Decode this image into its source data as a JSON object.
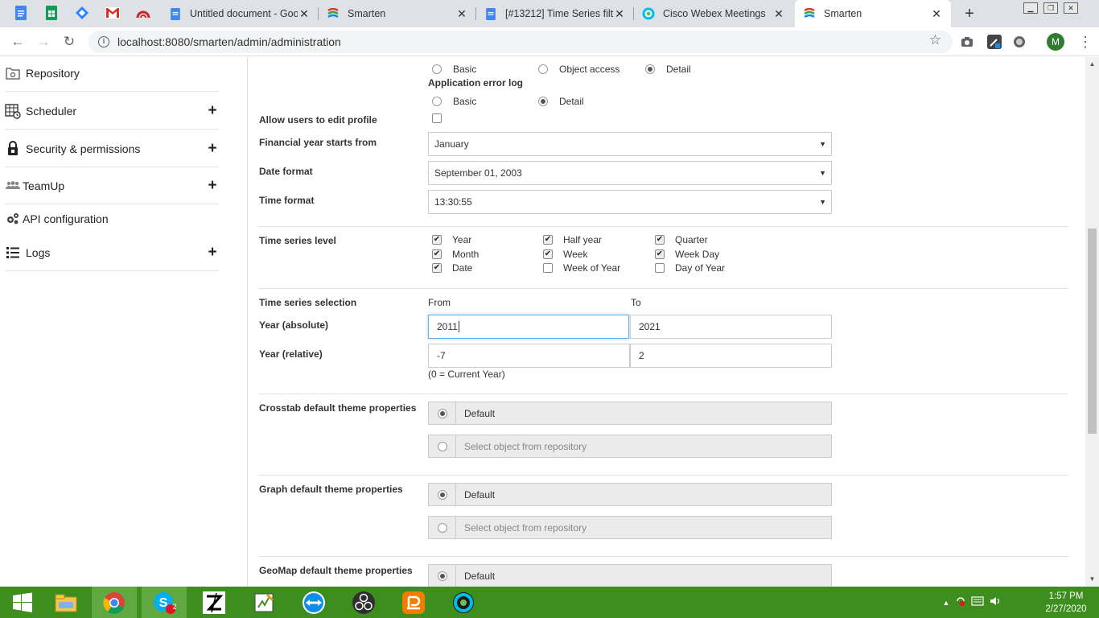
{
  "browser": {
    "tabs": [
      {
        "title": "Untitled document - Goo",
        "icon": "google-docs-icon"
      },
      {
        "title": "Smarten",
        "icon": "smarten-icon"
      },
      {
        "title": "[#13212] Time Series filte",
        "icon": "google-docs-icon"
      },
      {
        "title": "Cisco Webex Meetings",
        "icon": "webex-icon"
      },
      {
        "title": "Smarten",
        "icon": "smarten-icon",
        "active": true
      }
    ],
    "pinned_icons": [
      "google-docs-icon",
      "google-sheets-icon",
      "jira-icon",
      "gmail-icon",
      "smarten-red-icon"
    ],
    "url": "localhost:8080/smarten/admin/administration",
    "profile_initial": "M"
  },
  "sidebar": {
    "items": [
      {
        "label": "Repository",
        "icon": "repository-icon",
        "expandable": false
      },
      {
        "label": "Scheduler",
        "icon": "scheduler-icon",
        "expandable": true
      },
      {
        "label": "Security & permissions",
        "icon": "lock-icon",
        "expandable": true
      },
      {
        "label": "TeamUp",
        "icon": "users-icon",
        "expandable": true
      },
      {
        "label": "API configuration",
        "icon": "gears-icon",
        "expandable": false
      },
      {
        "label": "Logs",
        "icon": "list-icon",
        "expandable": true
      }
    ],
    "plus_glyph": "+"
  },
  "form": {
    "audit_log": {
      "options": [
        {
          "label": "Basic",
          "selected": false
        },
        {
          "label": "Object access",
          "selected": false
        },
        {
          "label": "Detail",
          "selected": true
        }
      ]
    },
    "app_error_log": {
      "label": "Application error log",
      "options": [
        {
          "label": "Basic",
          "selected": false
        },
        {
          "label": "Detail",
          "selected": true
        }
      ]
    },
    "allow_edit_profile": {
      "label": "Allow users to edit profile",
      "checked": false
    },
    "financial_year": {
      "label": "Financial year starts from",
      "value": "January"
    },
    "date_format": {
      "label": "Date format",
      "value": "September 01, 2003"
    },
    "time_format": {
      "label": "Time format",
      "value": "13:30:55"
    },
    "time_series_level": {
      "label": "Time series level",
      "options": [
        {
          "label": "Year",
          "checked": true
        },
        {
          "label": "Half year",
          "checked": true
        },
        {
          "label": "Quarter",
          "checked": true
        },
        {
          "label": "Month",
          "checked": true
        },
        {
          "label": "Week",
          "checked": true
        },
        {
          "label": "Week Day",
          "checked": true
        },
        {
          "label": "Date",
          "checked": true
        },
        {
          "label": "Week of Year",
          "checked": false
        },
        {
          "label": "Day of Year",
          "checked": false
        }
      ]
    },
    "time_series_selection": {
      "label": "Time series selection",
      "from_label": "From",
      "to_label": "To",
      "year_absolute": {
        "label": "Year (absolute)",
        "from": "2011",
        "to": "2021"
      },
      "year_relative": {
        "label": "Year (relative)",
        "from": "-7",
        "to": "2"
      },
      "hint": "(0 = Current Year)"
    },
    "crosstab_theme": {
      "label": "Crosstab default theme properties",
      "default_label": "Default",
      "repo_label": "Select object from repository"
    },
    "graph_theme": {
      "label": "Graph default theme properties",
      "default_label": "Default",
      "repo_label": "Select object from repository"
    },
    "geomap_theme": {
      "label": "GeoMap default theme properties",
      "default_label": "Default"
    }
  },
  "taskbar": {
    "apps": [
      "windows-start-icon",
      "file-explorer-icon",
      "chrome-icon",
      "skype-icon",
      "app-z-icon",
      "editor-icon",
      "teamviewer-icon",
      "obs-icon",
      "slides-icon",
      "webex-icon"
    ],
    "skype_badge": "2",
    "time": "1:57 PM",
    "date": "2/27/2020"
  },
  "colors": {
    "taskbar": "#3d8d1f",
    "focus_border": "#66afe9",
    "tabbar": "#dee1e6"
  }
}
